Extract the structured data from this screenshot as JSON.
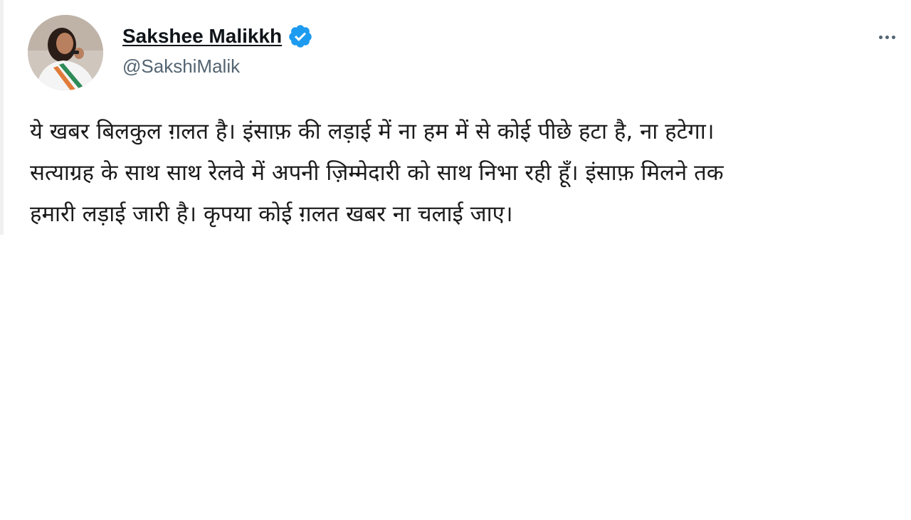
{
  "author": {
    "display_name": "Sakshee Malikkh",
    "handle": "@SakshiMalik",
    "verified": true,
    "verified_icon": "verified-badge-icon",
    "avatar_icon": "profile-photo",
    "accent_color": "#1d9bf0"
  },
  "tweet": {
    "lines": [
      "ये खबर बिलकुल ग़लत है। इंसाफ़ की लड़ाई में ना हम में से कोई पीछे हटा है, ना हटेगा।",
      "सत्याग्रह के साथ साथ रेलवे में अपनी ज़िम्मेदारी को साथ निभा रही हूँ। इंसाफ़ मिलने तक",
      "हमारी लड़ाई जारी है। कृपया कोई ग़लत खबर ना चलाई जाए।"
    ]
  },
  "menu": {
    "more_icon": "more-horizontal-icon"
  }
}
